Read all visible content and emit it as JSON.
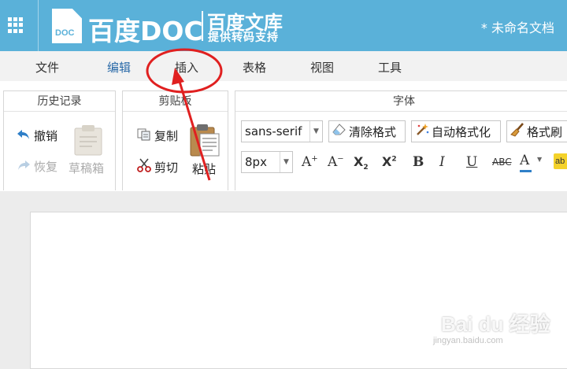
{
  "header": {
    "logo_doc_badge": "DOC",
    "logo_main": "百度DOC",
    "logo_wenku": "百度文库",
    "logo_tagline": "提供转码支持",
    "document_title": "* 未命名文档"
  },
  "menu": {
    "file": "文件",
    "edit": "编辑",
    "insert": "插入",
    "table": "表格",
    "view": "视图",
    "tools": "工具"
  },
  "ribbon": {
    "history": {
      "title": "历史记录",
      "undo": "撤销",
      "redo": "恢复",
      "drafts": "草稿箱"
    },
    "clipboard": {
      "title": "剪贴板",
      "copy": "复制",
      "cut": "剪切",
      "paste": "粘贴"
    },
    "font": {
      "title": "字体",
      "font_family": "sans-serif",
      "font_size": "8px",
      "clear_format": "清除格式",
      "auto_format": "自动格式化",
      "format_painter": "格式刷"
    }
  },
  "watermark": {
    "brand": "Bai du 经验",
    "url": "jingyan.baidu.com"
  },
  "colors": {
    "header_bg": "#5ab1d9",
    "active_menu": "#2a6aa8",
    "annotation": "#e02020"
  }
}
